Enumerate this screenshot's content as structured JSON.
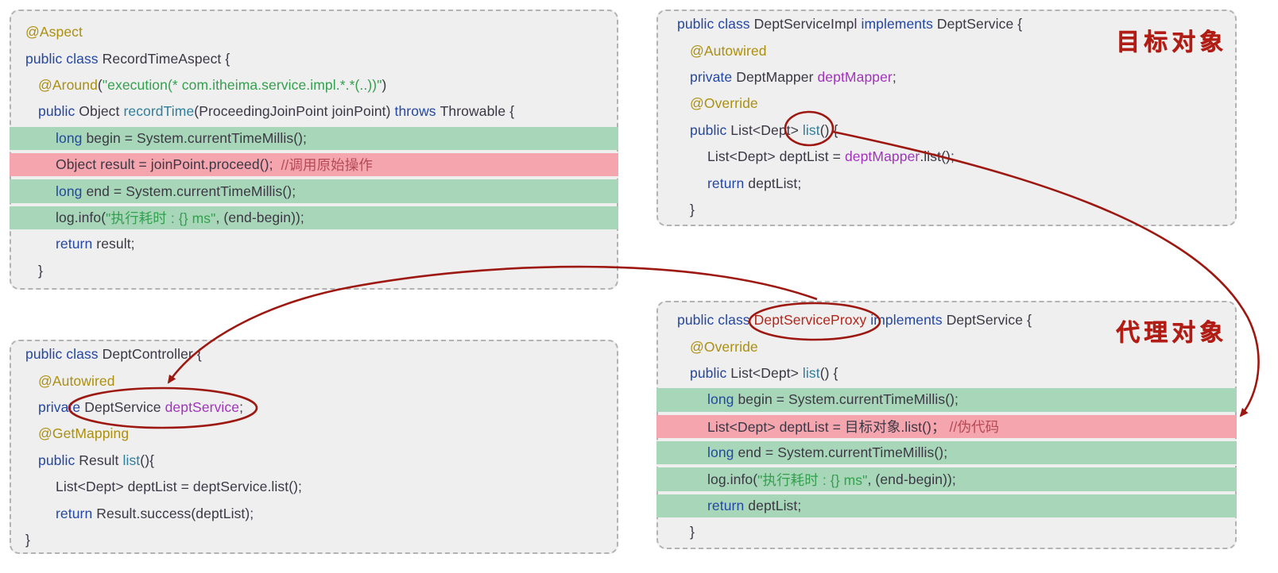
{
  "palette": {
    "panel_bg": "#efefef",
    "panel_border": "#b3b3b3",
    "keyword": "#2447a5",
    "annotation": "#ab8f10",
    "string": "#33a04e",
    "method": "#2d7f9d",
    "field": "#a233bd",
    "plain": "#3b3744",
    "comment": "#b44a56",
    "class_red": "#b1271c",
    "highlight_green": "#a7d7b8",
    "highlight_pink": "#f5a5ae",
    "accent_red": "#9e1812",
    "label_red": "#b11d15"
  },
  "overlay": {
    "target_label": "目标对象",
    "proxy_label": "代理对象"
  },
  "panels": [
    {
      "name": "aspect-panel",
      "lines": [
        {
          "indent": 0,
          "highlight": "none",
          "tokens": [
            {
              "type": "ann",
              "text": "@Aspect"
            }
          ]
        },
        {
          "indent": 0,
          "highlight": "none",
          "tokens": [
            {
              "type": "kw",
              "text": "public class "
            },
            {
              "type": "plain",
              "text": "RecordTimeAspect {"
            }
          ]
        },
        {
          "indent": 1,
          "highlight": "none",
          "tokens": [
            {
              "type": "ann",
              "text": "@Around"
            },
            {
              "type": "plain",
              "text": "("
            },
            {
              "type": "str",
              "text": "\"execution(* com.itheima.service.impl.*.*(..))\""
            },
            {
              "type": "plain",
              "text": ")"
            }
          ]
        },
        {
          "indent": 1,
          "highlight": "none",
          "tokens": [
            {
              "type": "kw",
              "text": "public "
            },
            {
              "type": "plain",
              "text": "Object "
            },
            {
              "type": "method",
              "text": "recordTime"
            },
            {
              "type": "plain",
              "text": "(ProceedingJoinPoint joinPoint) "
            },
            {
              "type": "kw",
              "text": "throws "
            },
            {
              "type": "plain",
              "text": "Throwable {"
            }
          ]
        },
        {
          "indent": 2,
          "highlight": "green",
          "tokens": [
            {
              "type": "kw",
              "text": "long "
            },
            {
              "type": "plain",
              "text": "begin = System.currentTimeMillis();"
            }
          ]
        },
        {
          "indent": 2,
          "highlight": "pink",
          "tokens": [
            {
              "type": "plain",
              "text": "Object result = joinPoint.proceed();  "
            },
            {
              "type": "cmt",
              "text": "//调用原始操作"
            }
          ]
        },
        {
          "indent": 2,
          "highlight": "green",
          "tokens": [
            {
              "type": "kw",
              "text": "long "
            },
            {
              "type": "plain",
              "text": "end = System.currentTimeMillis();"
            }
          ]
        },
        {
          "indent": 2,
          "highlight": "green",
          "tokens": [
            {
              "type": "plain",
              "text": "log.info("
            },
            {
              "type": "str",
              "text": "\"执行耗时 : {} ms\""
            },
            {
              "type": "plain",
              "text": ", (end-begin));"
            }
          ]
        },
        {
          "indent": 2,
          "highlight": "none",
          "tokens": [
            {
              "type": "kw",
              "text": "return "
            },
            {
              "type": "plain",
              "text": "result;"
            }
          ]
        },
        {
          "indent": 1,
          "highlight": "none",
          "tokens": [
            {
              "type": "plain",
              "text": "}"
            }
          ]
        }
      ]
    },
    {
      "name": "target-service-panel",
      "lines": [
        {
          "indent": 0,
          "highlight": "none",
          "tokens": [
            {
              "type": "kw",
              "text": "public class "
            },
            {
              "type": "plain",
              "text": "DeptServiceImpl "
            },
            {
              "type": "kw",
              "text": "implements "
            },
            {
              "type": "plain",
              "text": "DeptService {"
            }
          ]
        },
        {
          "indent": 1,
          "highlight": "none",
          "tokens": [
            {
              "type": "ann",
              "text": "@Autowired"
            }
          ]
        },
        {
          "indent": 1,
          "highlight": "none",
          "tokens": [
            {
              "type": "kw",
              "text": "private "
            },
            {
              "type": "plain",
              "text": "DeptMapper "
            },
            {
              "type": "field",
              "text": "deptMapper"
            },
            {
              "type": "plain",
              "text": ";"
            }
          ]
        },
        {
          "indent": 1,
          "highlight": "none",
          "tokens": [
            {
              "type": "ann",
              "text": "@Override"
            }
          ]
        },
        {
          "indent": 1,
          "highlight": "none",
          "tokens": [
            {
              "type": "kw",
              "text": "public "
            },
            {
              "type": "plain",
              "text": "List<Dept> "
            },
            {
              "type": "method",
              "text": "list"
            },
            {
              "type": "plain",
              "text": "() {"
            }
          ]
        },
        {
          "indent": 2,
          "highlight": "none",
          "tokens": [
            {
              "type": "plain",
              "text": "List<Dept> deptList = "
            },
            {
              "type": "field",
              "text": "deptMapper"
            },
            {
              "type": "plain",
              "text": ".list();"
            }
          ]
        },
        {
          "indent": 2,
          "highlight": "none",
          "tokens": [
            {
              "type": "kw",
              "text": "return "
            },
            {
              "type": "plain",
              "text": "deptList;"
            }
          ]
        },
        {
          "indent": 1,
          "highlight": "none",
          "tokens": [
            {
              "type": "plain",
              "text": "}"
            }
          ]
        }
      ]
    },
    {
      "name": "controller-panel",
      "lines": [
        {
          "indent": 0,
          "highlight": "none",
          "tokens": [
            {
              "type": "kw",
              "text": "public class "
            },
            {
              "type": "plain",
              "text": "DeptController {"
            }
          ]
        },
        {
          "indent": 1,
          "highlight": "none",
          "tokens": [
            {
              "type": "ann",
              "text": "@Autowired"
            }
          ]
        },
        {
          "indent": 1,
          "highlight": "none",
          "tokens": [
            {
              "type": "kw",
              "text": "private "
            },
            {
              "type": "plain",
              "text": "DeptService "
            },
            {
              "type": "field",
              "text": "deptService"
            },
            {
              "type": "plain",
              "text": ";"
            }
          ]
        },
        {
          "indent": 1,
          "highlight": "none",
          "tokens": [
            {
              "type": "ann",
              "text": "@GetMapping"
            }
          ]
        },
        {
          "indent": 1,
          "highlight": "none",
          "tokens": [
            {
              "type": "kw",
              "text": "public "
            },
            {
              "type": "plain",
              "text": "Result "
            },
            {
              "type": "method",
              "text": "list"
            },
            {
              "type": "plain",
              "text": "(){"
            }
          ]
        },
        {
          "indent": 2,
          "highlight": "none",
          "tokens": [
            {
              "type": "plain",
              "text": "List<Dept> deptList = deptService.list();"
            }
          ]
        },
        {
          "indent": 2,
          "highlight": "none",
          "tokens": [
            {
              "type": "kw",
              "text": "return "
            },
            {
              "type": "plain",
              "text": "Result.success(deptList);"
            }
          ]
        },
        {
          "indent": 0,
          "highlight": "none",
          "tokens": [
            {
              "type": "plain",
              "text": "}"
            }
          ]
        }
      ]
    },
    {
      "name": "proxy-panel",
      "lines": [
        {
          "indent": 0,
          "highlight": "none",
          "tokens": [
            {
              "type": "kw",
              "text": "public class "
            },
            {
              "type": "redname",
              "text": "DeptServiceProxy "
            },
            {
              "type": "kw",
              "text": "implements "
            },
            {
              "type": "plain",
              "text": "DeptService {"
            }
          ]
        },
        {
          "indent": 1,
          "highlight": "none",
          "tokens": [
            {
              "type": "ann",
              "text": "@Override"
            }
          ]
        },
        {
          "indent": 1,
          "highlight": "none",
          "tokens": [
            {
              "type": "kw",
              "text": "public "
            },
            {
              "type": "plain",
              "text": "List<Dept> "
            },
            {
              "type": "method",
              "text": "list"
            },
            {
              "type": "plain",
              "text": "() {"
            }
          ]
        },
        {
          "indent": 2,
          "highlight": "green",
          "tokens": [
            {
              "type": "kw",
              "text": "long "
            },
            {
              "type": "plain",
              "text": "begin = System.currentTimeMillis();"
            }
          ]
        },
        {
          "indent": 2,
          "highlight": "pink",
          "tokens": [
            {
              "type": "plain",
              "text": "List<Dept> deptList = 目标对象.list()； "
            },
            {
              "type": "cmt",
              "text": "//伪代码"
            }
          ]
        },
        {
          "indent": 2,
          "highlight": "green",
          "tokens": [
            {
              "type": "kw",
              "text": "long "
            },
            {
              "type": "plain",
              "text": "end = System.currentTimeMillis();"
            }
          ]
        },
        {
          "indent": 2,
          "highlight": "green",
          "tokens": [
            {
              "type": "plain",
              "text": "log.info("
            },
            {
              "type": "str",
              "text": "\"执行耗时 : {} ms\""
            },
            {
              "type": "plain",
              "text": ", (end-begin));"
            }
          ]
        },
        {
          "indent": 2,
          "highlight": "green",
          "tokens": [
            {
              "type": "kw",
              "text": "return "
            },
            {
              "type": "plain",
              "text": "deptList;"
            }
          ]
        },
        {
          "indent": 1,
          "highlight": "none",
          "tokens": [
            {
              "type": "plain",
              "text": "}"
            }
          ]
        }
      ]
    }
  ]
}
